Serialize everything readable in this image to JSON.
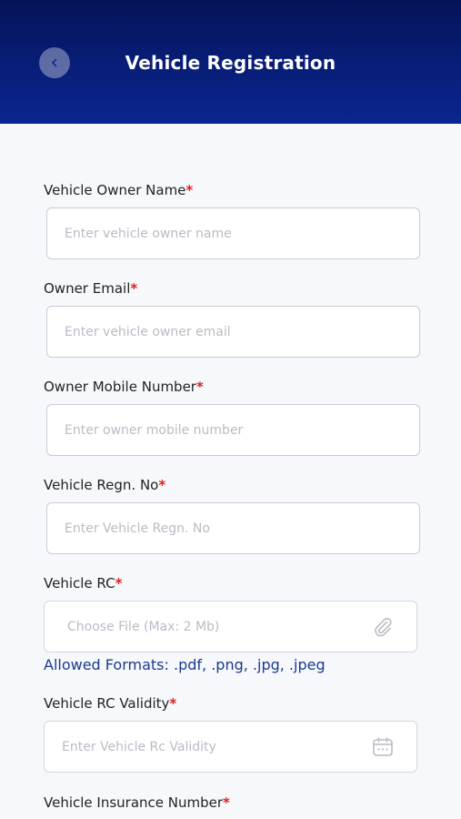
{
  "header": {
    "title": "Vehicle Registration"
  },
  "form": {
    "owner_name": {
      "label": "Vehicle Owner Name",
      "required_mark": "*",
      "placeholder": "Enter vehicle owner name"
    },
    "owner_email": {
      "label": "Owner Email",
      "required_mark": "*",
      "placeholder": "Enter vehicle owner email"
    },
    "owner_mobile": {
      "label": "Owner Mobile Number",
      "required_mark": "*",
      "placeholder": "Enter owner mobile number"
    },
    "regn_no": {
      "label": "Vehicle Regn. No",
      "required_mark": "*",
      "placeholder": "Enter Vehicle Regn. No"
    },
    "rc": {
      "label": "Vehicle RC",
      "required_mark": "*",
      "placeholder": "Choose File (Max: 2 Mb)",
      "icon": "paperclip-icon"
    },
    "allowed_formats": "Allowed Formats: .pdf, .png, .jpg, .jpeg",
    "rc_validity": {
      "label": "Vehicle RC Validity",
      "required_mark": "*",
      "placeholder": "Enter Vehicle Rc Validity",
      "icon": "calendar-icon"
    },
    "insurance_number": {
      "label": "Vehicle Insurance Number",
      "required_mark": "*"
    }
  },
  "colors": {
    "header_top": "#04145a",
    "header_bottom": "#0b2690",
    "required": "#e02020",
    "link_blue": "#1b3a8f"
  }
}
